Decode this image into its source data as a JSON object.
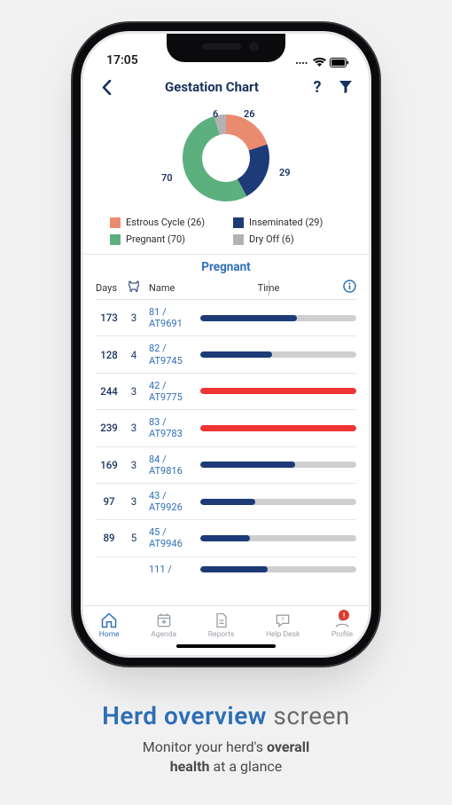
{
  "status": {
    "time": "17:05"
  },
  "header": {
    "title": "Gestation Chart"
  },
  "chart_data": {
    "type": "pie",
    "title": "",
    "series": [
      {
        "name": "Estrous Cycle",
        "value": 26,
        "color": "#e98b6f"
      },
      {
        "name": "Inseminated",
        "value": 29,
        "color": "#1d3b77"
      },
      {
        "name": "Pregnant",
        "value": 70,
        "color": "#5bb07e"
      },
      {
        "name": "Dry Off",
        "value": 6,
        "color": "#b2b2b2"
      }
    ],
    "annotations": {
      "top": "26",
      "topleft": "6",
      "right": "29",
      "left": "70"
    }
  },
  "legend": [
    {
      "label": "Estrous Cycle (26)",
      "color": "#e98b6f"
    },
    {
      "label": "Inseminated (29)",
      "color": "#1d3b77"
    },
    {
      "label": "Pregnant (70)",
      "color": "#5bb07e"
    },
    {
      "label": "Dry Off (6)",
      "color": "#b2b2b2"
    }
  ],
  "section": {
    "title": "Pregnant",
    "columns": {
      "days": "Days",
      "name": "Name",
      "time": "Time"
    }
  },
  "rows": [
    {
      "days": "173",
      "cows": "3",
      "id1": "81 /",
      "id2": "AT9691",
      "pct": 62,
      "color": "#1d3b77"
    },
    {
      "days": "128",
      "cows": "4",
      "id1": "82 /",
      "id2": "AT9745",
      "pct": 46,
      "color": "#1d3b77"
    },
    {
      "days": "244",
      "cows": "3",
      "id1": "42 /",
      "id2": "AT9775",
      "pct": 100,
      "color": "#ef3434"
    },
    {
      "days": "239",
      "cows": "3",
      "id1": "83 /",
      "id2": "AT9783",
      "pct": 100,
      "color": "#ef3434"
    },
    {
      "days": "169",
      "cows": "3",
      "id1": "84 /",
      "id2": "AT9816",
      "pct": 61,
      "color": "#1d3b77"
    },
    {
      "days": "97",
      "cows": "3",
      "id1": "43 /",
      "id2": "AT9926",
      "pct": 35,
      "color": "#1d3b77"
    },
    {
      "days": "89",
      "cows": "5",
      "id1": "45 /",
      "id2": "AT9946",
      "pct": 32,
      "color": "#1d3b77"
    },
    {
      "days": "",
      "cows": "",
      "id1": "111 /",
      "id2": "",
      "pct": 43,
      "color": "#1d3b77"
    }
  ],
  "nav": {
    "home": "Home",
    "agenda": "Agenda",
    "reports": "Reports",
    "helpdesk": "Help Desk",
    "profile": "Profile",
    "badge": "!"
  },
  "marketing": {
    "title_accent": "Herd overview",
    "title_rest": " screen",
    "sub_pre": "Monitor your herd's ",
    "sub_b1": "overall",
    "sub_mid": " ",
    "sub_b2": "health",
    "sub_post": " at a glance"
  }
}
